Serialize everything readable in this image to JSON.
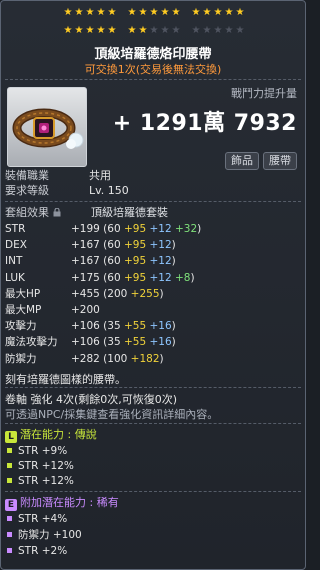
{
  "stars": {
    "groups": 6,
    "per_group": 5,
    "lit": 22,
    "total": 30
  },
  "item": {
    "title": "頂級培羅德烙印腰帶",
    "subtitle": "可交換1次(交易後無法交換)",
    "power_label": "戰鬥力提升量",
    "power_value": "+ 1291萬 7932",
    "category_badges": [
      "飾品",
      "腰帶"
    ],
    "job_label": "裝備職業",
    "job_value": "共用",
    "level_label": "要求等級",
    "level_value": "Lv. 150"
  },
  "set_effect": {
    "label": "套組效果",
    "value": "頂級培羅德套裝"
  },
  "stats": [
    {
      "name": "STR",
      "total": "+199",
      "base": "(60",
      "add1": "+95",
      "add2": "+12",
      "add3": "+32",
      "close": ")"
    },
    {
      "name": "DEX",
      "total": "+167",
      "base": "(60",
      "add1": "+95",
      "add2": "+12",
      "add3": "",
      "close": ")"
    },
    {
      "name": "INT",
      "total": "+167",
      "base": "(60",
      "add1": "+95",
      "add2": "+12",
      "add3": "",
      "close": ")"
    },
    {
      "name": "LUK",
      "total": "+175",
      "base": "(60",
      "add1": "+95",
      "add2": "+12",
      "add3": "+8",
      "close": ")"
    },
    {
      "name": "最大HP",
      "total": "+455",
      "base": "(200",
      "add1": "+255",
      "add2": "",
      "add3": "",
      "close": ")"
    },
    {
      "name": "最大MP",
      "total": "+200",
      "base": "",
      "add1": "",
      "add2": "",
      "add3": "",
      "close": ""
    },
    {
      "name": "攻擊力",
      "total": "+106",
      "base": "(35",
      "add1": "+55",
      "add2": "+16",
      "add3": "",
      "close": ")"
    },
    {
      "name": "魔法攻擊力",
      "total": "+106",
      "base": "(35",
      "add1": "+55",
      "add2": "+16",
      "add3": "",
      "close": ")"
    },
    {
      "name": "防禦力",
      "total": "+282",
      "base": "(100",
      "add1": "+182",
      "add2": "",
      "add3": "",
      "close": ")"
    }
  ],
  "description": "刻有培羅德圖樣的腰帶。",
  "scroll_line": "卷軸 強化 4次(剩餘0次,可恢復0次)",
  "npc_line": "可透過NPC/採集鍵查看強化資訊詳細內容。",
  "potential": {
    "badge": "L",
    "header": "潛在能力 : 傳說",
    "color": "#c8e63a",
    "lines": [
      "STR +9%",
      "STR +12%",
      "STR +12%"
    ]
  },
  "additional": {
    "badge": "E",
    "header": "附加潛在能力 : 稀有",
    "color": "#c98bff",
    "lines": [
      "STR +4%",
      "防禦力 +100",
      "STR +2%"
    ]
  },
  "colors": {
    "orange": "#ff9a3c",
    "star": "#ffcc22",
    "yellow": "#f1d33a",
    "blue": "#8ec6ff",
    "green": "#7fe07a"
  }
}
